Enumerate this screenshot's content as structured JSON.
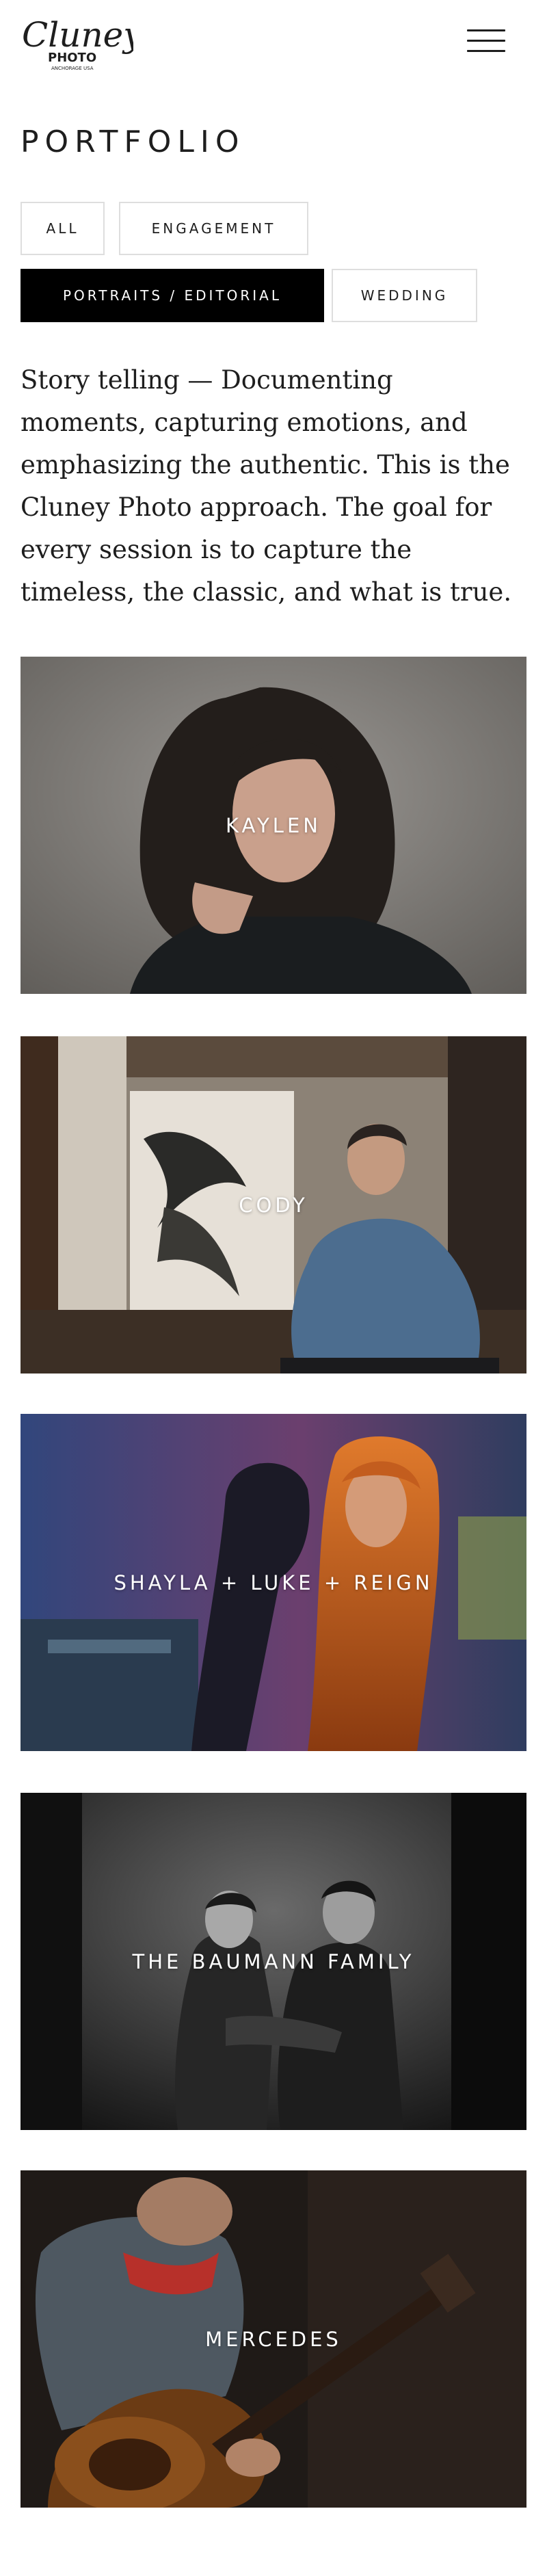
{
  "brand": {
    "logo_text": "Cluney",
    "logo_subtext": "PHOTO",
    "logo_small": "ANCHORAGE USA"
  },
  "header": {
    "menu_icon": "hamburger-icon"
  },
  "page": {
    "title": "PORTFOLIO"
  },
  "filters": [
    {
      "label": "ALL",
      "active": false
    },
    {
      "label": "ENGAGEMENT",
      "active": false
    },
    {
      "label": "PORTRAITS / EDITORIAL",
      "active": true
    },
    {
      "label": "WEDDING",
      "active": false
    }
  ],
  "intro": "Story telling — Documenting moments, capturing emotions, and emphasizing the authentic. This is the Cluney Photo approach. The goal for every session is to capture the timeless, the classic, and what is true.",
  "galleries": [
    {
      "title": "KAYLEN"
    },
    {
      "title": "CODY"
    },
    {
      "title": "SHAYLA + LUKE + REIGN"
    },
    {
      "title": "THE BAUMANN FAMILY"
    },
    {
      "title": "MERCEDES"
    }
  ],
  "colors": {
    "text": "#1e1e1e",
    "active_filter_bg": "#000000",
    "border": "#dedede",
    "background": "#ffffff"
  }
}
